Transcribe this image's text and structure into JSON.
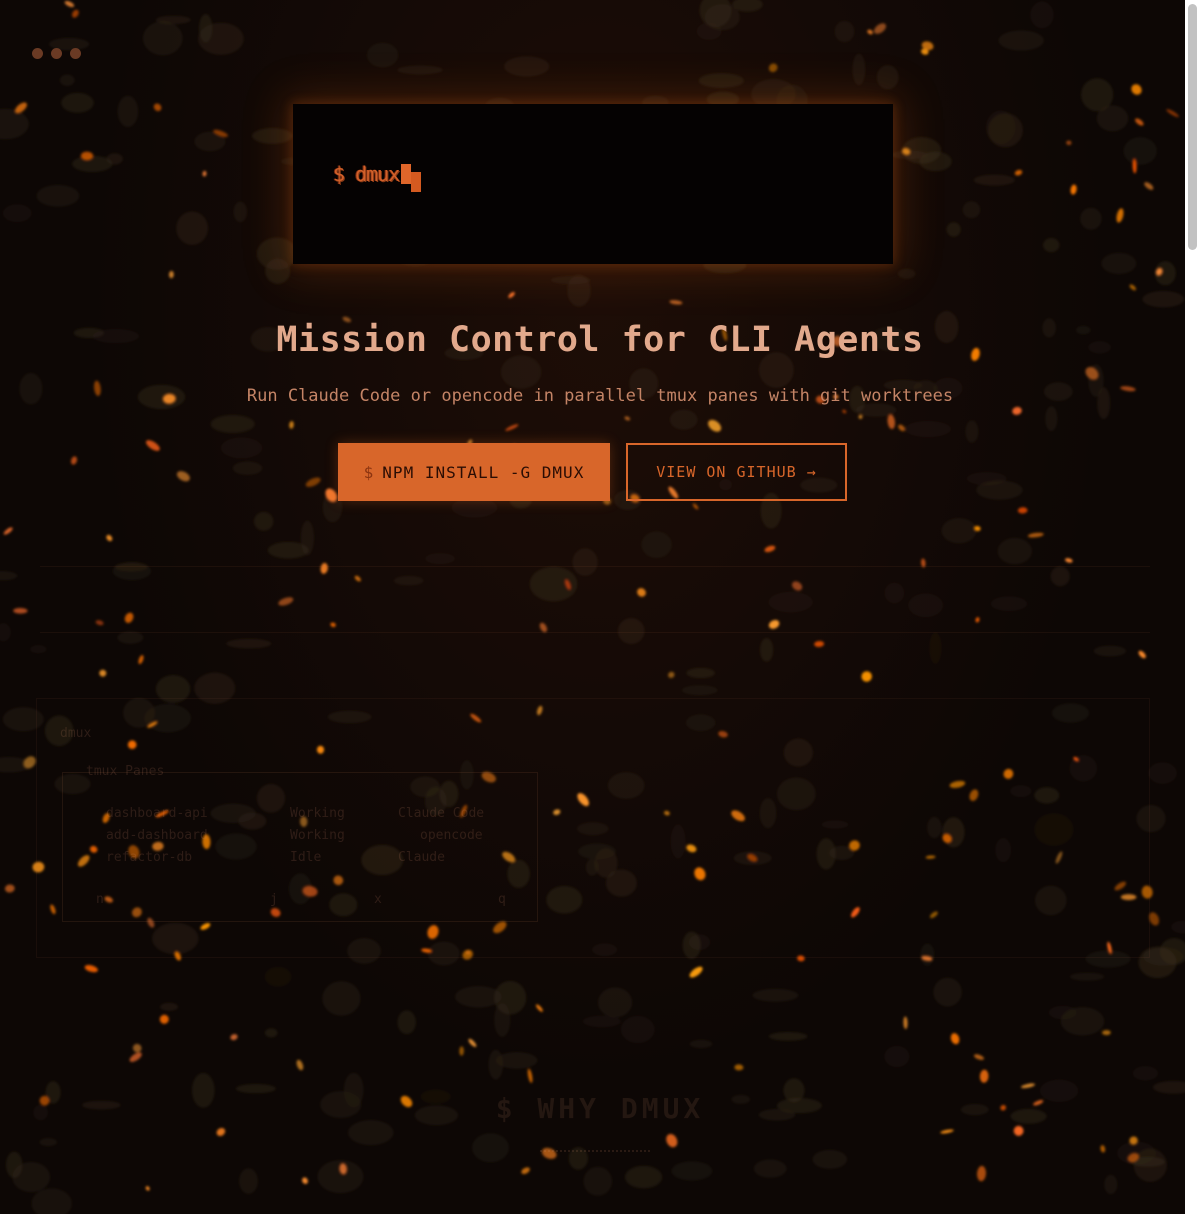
{
  "window": {
    "controls": [
      "dot",
      "dot",
      "dot"
    ]
  },
  "terminal": {
    "prompt_symbol": "$",
    "command": "dmux"
  },
  "hero": {
    "title": "Mission Control for CLI Agents",
    "subtitle": "Run Claude Code or opencode in parallel tmux panes with git worktrees"
  },
  "buttons": {
    "install_prefix": "$",
    "install_label": "NPM INSTALL -G DMUX",
    "github_label": "VIEW ON GITHUB →"
  },
  "demo": {
    "window_label": "dmux",
    "panes_label": "tmux Panes",
    "rows": [
      {
        "name": "dashboard-api",
        "status": "Working",
        "agent": "Claude Code"
      },
      {
        "name": "add-dashboard",
        "status": "Working",
        "agent": "opencode"
      },
      {
        "name": "refactor-db",
        "status": "Idle",
        "agent": "Claude"
      }
    ],
    "footer_items": [
      "n",
      "j",
      "x",
      "q"
    ]
  },
  "footer": {
    "logo": "$ WHY DMUX"
  },
  "colors": {
    "accent": "#d8662a",
    "background": "#0d0705",
    "title": "#e2a98c",
    "subtitle": "#c48466"
  }
}
